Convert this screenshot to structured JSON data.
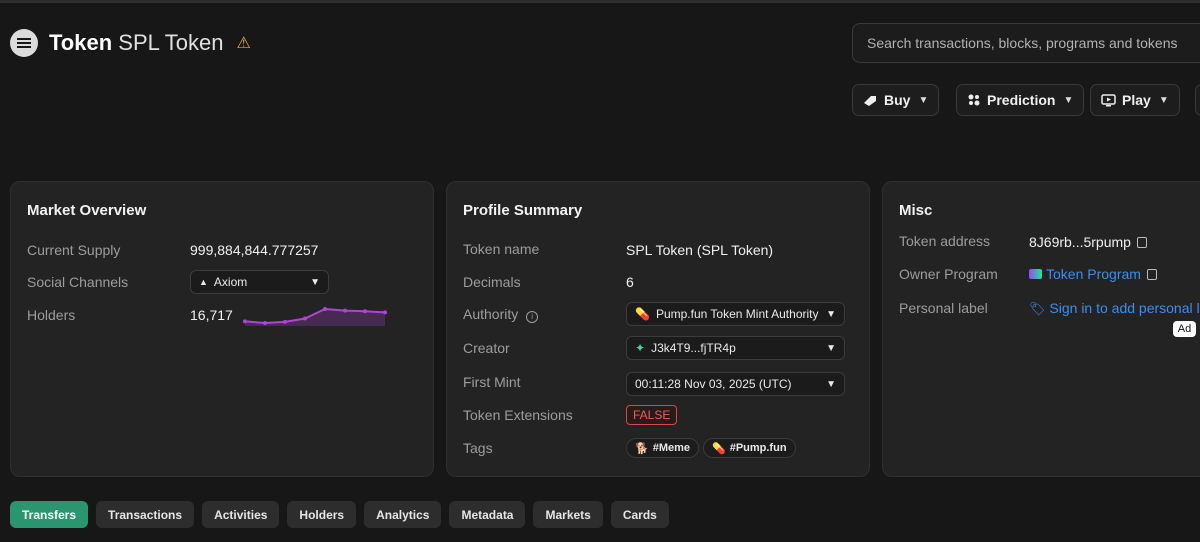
{
  "header": {
    "title": "Token",
    "subtitle": "SPL Token"
  },
  "search": {
    "placeholder": "Search transactions, blocks, programs and tokens"
  },
  "actions": {
    "buy": "Buy",
    "prediction": "Prediction",
    "play": "Play"
  },
  "market": {
    "title": "Market Overview",
    "supply_label": "Current Supply",
    "supply_value": "999,884,844.777257",
    "social_label": "Social Channels",
    "social_value": "Axiom",
    "holders_label": "Holders",
    "holders_value": "16,717",
    "sparkline": [
      2.2,
      1.9,
      2.1,
      2.7,
      4.4,
      4.1,
      4.0,
      3.8
    ],
    "sparkline_color": "#b044d9"
  },
  "profile": {
    "title": "Profile Summary",
    "token_name_label": "Token name",
    "token_name_value": "SPL Token (SPL Token)",
    "decimals_label": "Decimals",
    "decimals_value": "6",
    "authority_label": "Authority",
    "authority_value": "Pump.fun Token Mint Authority",
    "creator_label": "Creator",
    "creator_value": "J3k4T9...fjTR4p",
    "first_mint_label": "First Mint",
    "first_mint_value": "00:11:28 Nov 03, 2025 (UTC)",
    "extensions_label": "Token Extensions",
    "extensions_value": "FALSE",
    "tags_label": "Tags",
    "tags": [
      "#Meme",
      "#Pump.fun"
    ]
  },
  "misc": {
    "title": "Misc",
    "address_label": "Token address",
    "address_value": "8J69rb...5rpump",
    "owner_label": "Owner Program",
    "owner_value": "Token Program",
    "personal_label": "Personal label",
    "personal_value": "Sign in to add personal la",
    "ad": "Ad"
  },
  "tabs": [
    "Transfers",
    "Transactions",
    "Activities",
    "Holders",
    "Analytics",
    "Metadata",
    "Markets",
    "Cards"
  ],
  "colors": {
    "accent": "#2a9670",
    "link": "#3c8ef0",
    "warning": "#e7a64a",
    "danger": "#ef5a5a"
  }
}
